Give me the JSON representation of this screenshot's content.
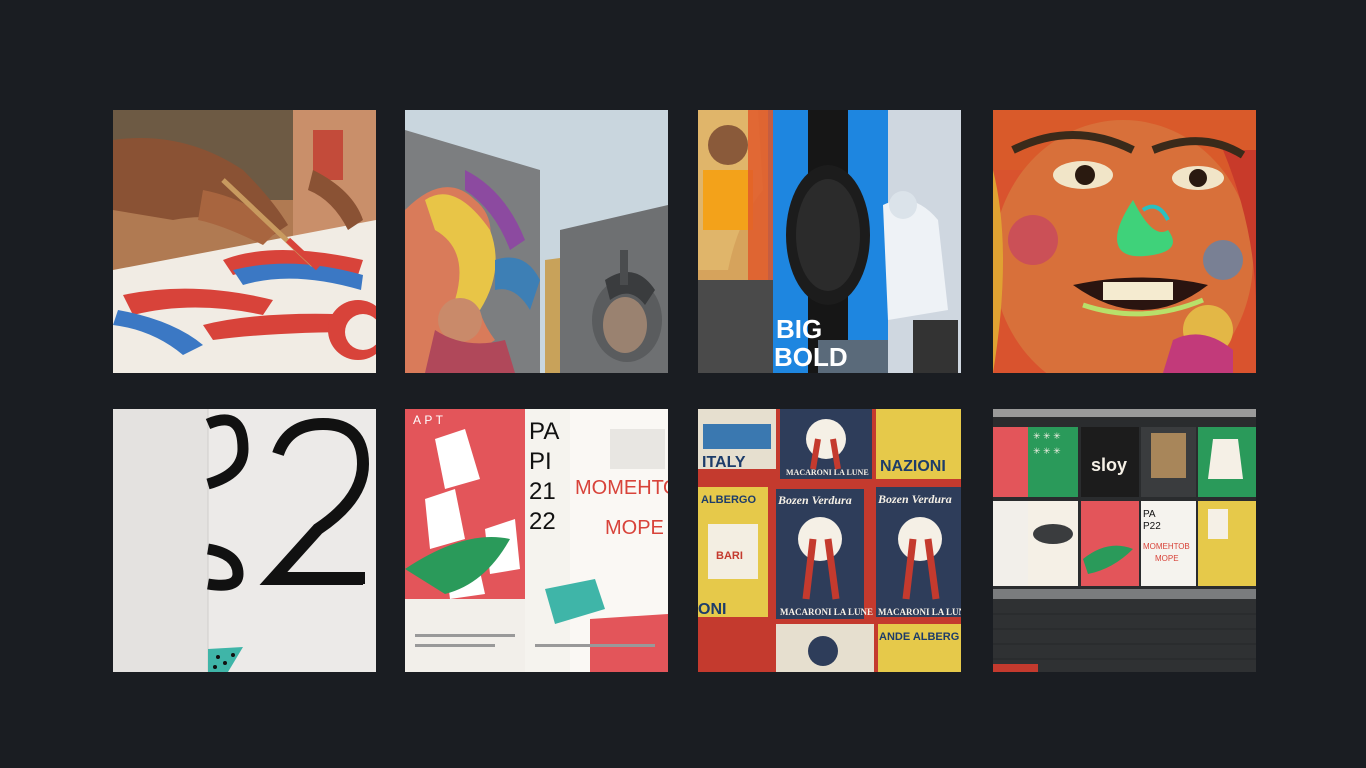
{
  "colors": {
    "background": "#1a1d22"
  },
  "gallery": {
    "tiles": [
      {
        "id": 1,
        "subject": "painting-hand-icon"
      },
      {
        "id": 2,
        "subject": "building-murals-icon"
      },
      {
        "id": 3,
        "subject": "watch-billboard-icon",
        "texts": {
          "line1": "BIG",
          "line2": "BOLD"
        }
      },
      {
        "id": 4,
        "subject": "face-mural-icon"
      },
      {
        "id": 5,
        "subject": "typography-poster-icon"
      },
      {
        "id": 6,
        "subject": "poster-collage-icon",
        "texts": {
          "top": "А Р Т",
          "left1": "РА",
          "left2": "РІ",
          "left3": "21",
          "left4": "22",
          "red1": "МОМЕНТОВ",
          "red2": "МОРЕ"
        }
      },
      {
        "id": 7,
        "subject": "vintage-posters-icon",
        "texts": {
          "italy": "ITALY",
          "nazioni": "NAZIONI",
          "macaroni": "MACARONI LA LUNE",
          "bozen": "Bozen Verdura",
          "albergo": "ALBERGO",
          "bari": "BARI",
          "oni": "ONI",
          "grande": "ANDE ALBERG"
        }
      },
      {
        "id": 8,
        "subject": "poster-wall-icon",
        "texts": {
          "sloy": "sloy",
          "p22a": "PA",
          "p22b": "Р22",
          "moment": "МОМЕНТОВ",
          "more": "МОРЕ"
        }
      }
    ]
  }
}
